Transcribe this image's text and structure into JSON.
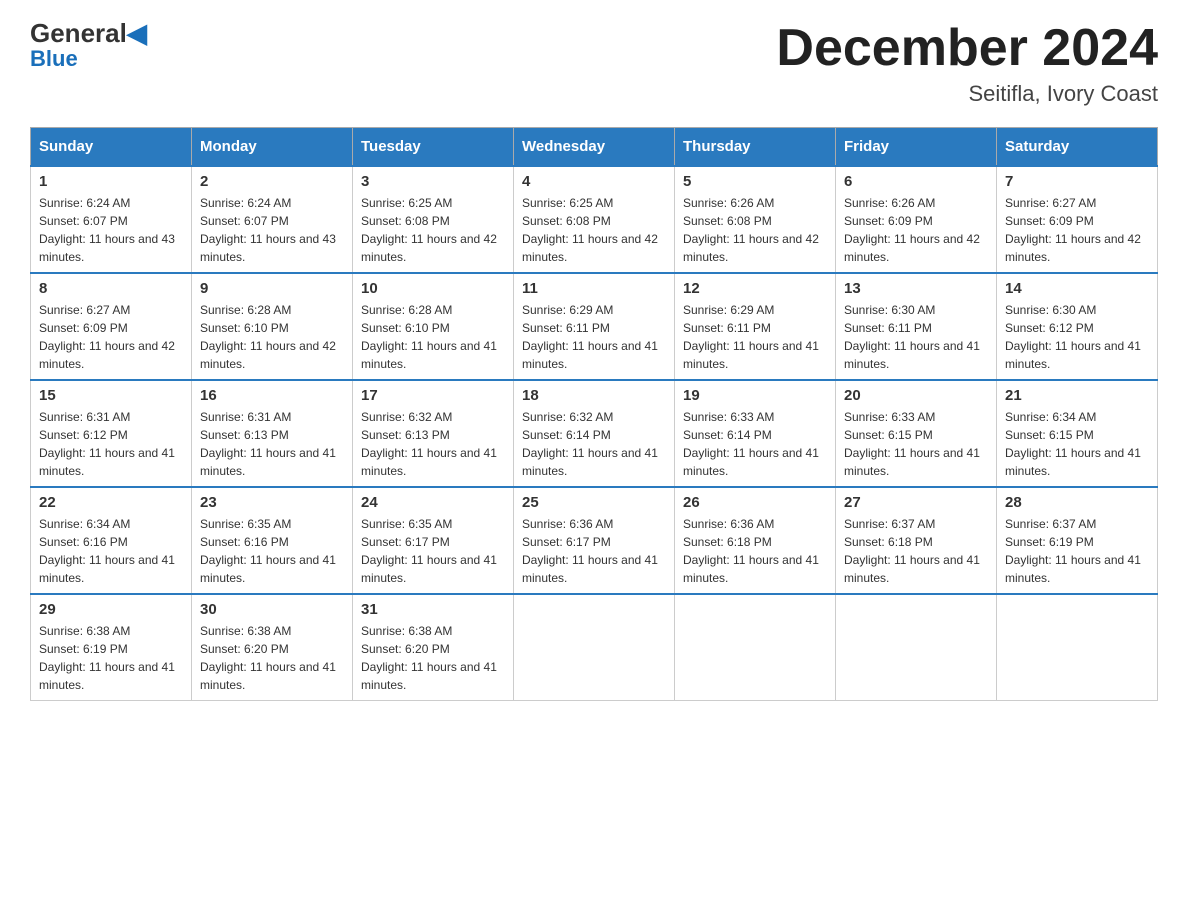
{
  "logo": {
    "general": "General",
    "blue": "Blue"
  },
  "title": "December 2024",
  "subtitle": "Seitifla, Ivory Coast",
  "days_of_week": [
    "Sunday",
    "Monday",
    "Tuesday",
    "Wednesday",
    "Thursday",
    "Friday",
    "Saturday"
  ],
  "weeks": [
    [
      {
        "day": "1",
        "sunrise": "6:24 AM",
        "sunset": "6:07 PM",
        "daylight": "11 hours and 43 minutes."
      },
      {
        "day": "2",
        "sunrise": "6:24 AM",
        "sunset": "6:07 PM",
        "daylight": "11 hours and 43 minutes."
      },
      {
        "day": "3",
        "sunrise": "6:25 AM",
        "sunset": "6:08 PM",
        "daylight": "11 hours and 42 minutes."
      },
      {
        "day": "4",
        "sunrise": "6:25 AM",
        "sunset": "6:08 PM",
        "daylight": "11 hours and 42 minutes."
      },
      {
        "day": "5",
        "sunrise": "6:26 AM",
        "sunset": "6:08 PM",
        "daylight": "11 hours and 42 minutes."
      },
      {
        "day": "6",
        "sunrise": "6:26 AM",
        "sunset": "6:09 PM",
        "daylight": "11 hours and 42 minutes."
      },
      {
        "day": "7",
        "sunrise": "6:27 AM",
        "sunset": "6:09 PM",
        "daylight": "11 hours and 42 minutes."
      }
    ],
    [
      {
        "day": "8",
        "sunrise": "6:27 AM",
        "sunset": "6:09 PM",
        "daylight": "11 hours and 42 minutes."
      },
      {
        "day": "9",
        "sunrise": "6:28 AM",
        "sunset": "6:10 PM",
        "daylight": "11 hours and 42 minutes."
      },
      {
        "day": "10",
        "sunrise": "6:28 AM",
        "sunset": "6:10 PM",
        "daylight": "11 hours and 41 minutes."
      },
      {
        "day": "11",
        "sunrise": "6:29 AM",
        "sunset": "6:11 PM",
        "daylight": "11 hours and 41 minutes."
      },
      {
        "day": "12",
        "sunrise": "6:29 AM",
        "sunset": "6:11 PM",
        "daylight": "11 hours and 41 minutes."
      },
      {
        "day": "13",
        "sunrise": "6:30 AM",
        "sunset": "6:11 PM",
        "daylight": "11 hours and 41 minutes."
      },
      {
        "day": "14",
        "sunrise": "6:30 AM",
        "sunset": "6:12 PM",
        "daylight": "11 hours and 41 minutes."
      }
    ],
    [
      {
        "day": "15",
        "sunrise": "6:31 AM",
        "sunset": "6:12 PM",
        "daylight": "11 hours and 41 minutes."
      },
      {
        "day": "16",
        "sunrise": "6:31 AM",
        "sunset": "6:13 PM",
        "daylight": "11 hours and 41 minutes."
      },
      {
        "day": "17",
        "sunrise": "6:32 AM",
        "sunset": "6:13 PM",
        "daylight": "11 hours and 41 minutes."
      },
      {
        "day": "18",
        "sunrise": "6:32 AM",
        "sunset": "6:14 PM",
        "daylight": "11 hours and 41 minutes."
      },
      {
        "day": "19",
        "sunrise": "6:33 AM",
        "sunset": "6:14 PM",
        "daylight": "11 hours and 41 minutes."
      },
      {
        "day": "20",
        "sunrise": "6:33 AM",
        "sunset": "6:15 PM",
        "daylight": "11 hours and 41 minutes."
      },
      {
        "day": "21",
        "sunrise": "6:34 AM",
        "sunset": "6:15 PM",
        "daylight": "11 hours and 41 minutes."
      }
    ],
    [
      {
        "day": "22",
        "sunrise": "6:34 AM",
        "sunset": "6:16 PM",
        "daylight": "11 hours and 41 minutes."
      },
      {
        "day": "23",
        "sunrise": "6:35 AM",
        "sunset": "6:16 PM",
        "daylight": "11 hours and 41 minutes."
      },
      {
        "day": "24",
        "sunrise": "6:35 AM",
        "sunset": "6:17 PM",
        "daylight": "11 hours and 41 minutes."
      },
      {
        "day": "25",
        "sunrise": "6:36 AM",
        "sunset": "6:17 PM",
        "daylight": "11 hours and 41 minutes."
      },
      {
        "day": "26",
        "sunrise": "6:36 AM",
        "sunset": "6:18 PM",
        "daylight": "11 hours and 41 minutes."
      },
      {
        "day": "27",
        "sunrise": "6:37 AM",
        "sunset": "6:18 PM",
        "daylight": "11 hours and 41 minutes."
      },
      {
        "day": "28",
        "sunrise": "6:37 AM",
        "sunset": "6:19 PM",
        "daylight": "11 hours and 41 minutes."
      }
    ],
    [
      {
        "day": "29",
        "sunrise": "6:38 AM",
        "sunset": "6:19 PM",
        "daylight": "11 hours and 41 minutes."
      },
      {
        "day": "30",
        "sunrise": "6:38 AM",
        "sunset": "6:20 PM",
        "daylight": "11 hours and 41 minutes."
      },
      {
        "day": "31",
        "sunrise": "6:38 AM",
        "sunset": "6:20 PM",
        "daylight": "11 hours and 41 minutes."
      },
      null,
      null,
      null,
      null
    ]
  ]
}
